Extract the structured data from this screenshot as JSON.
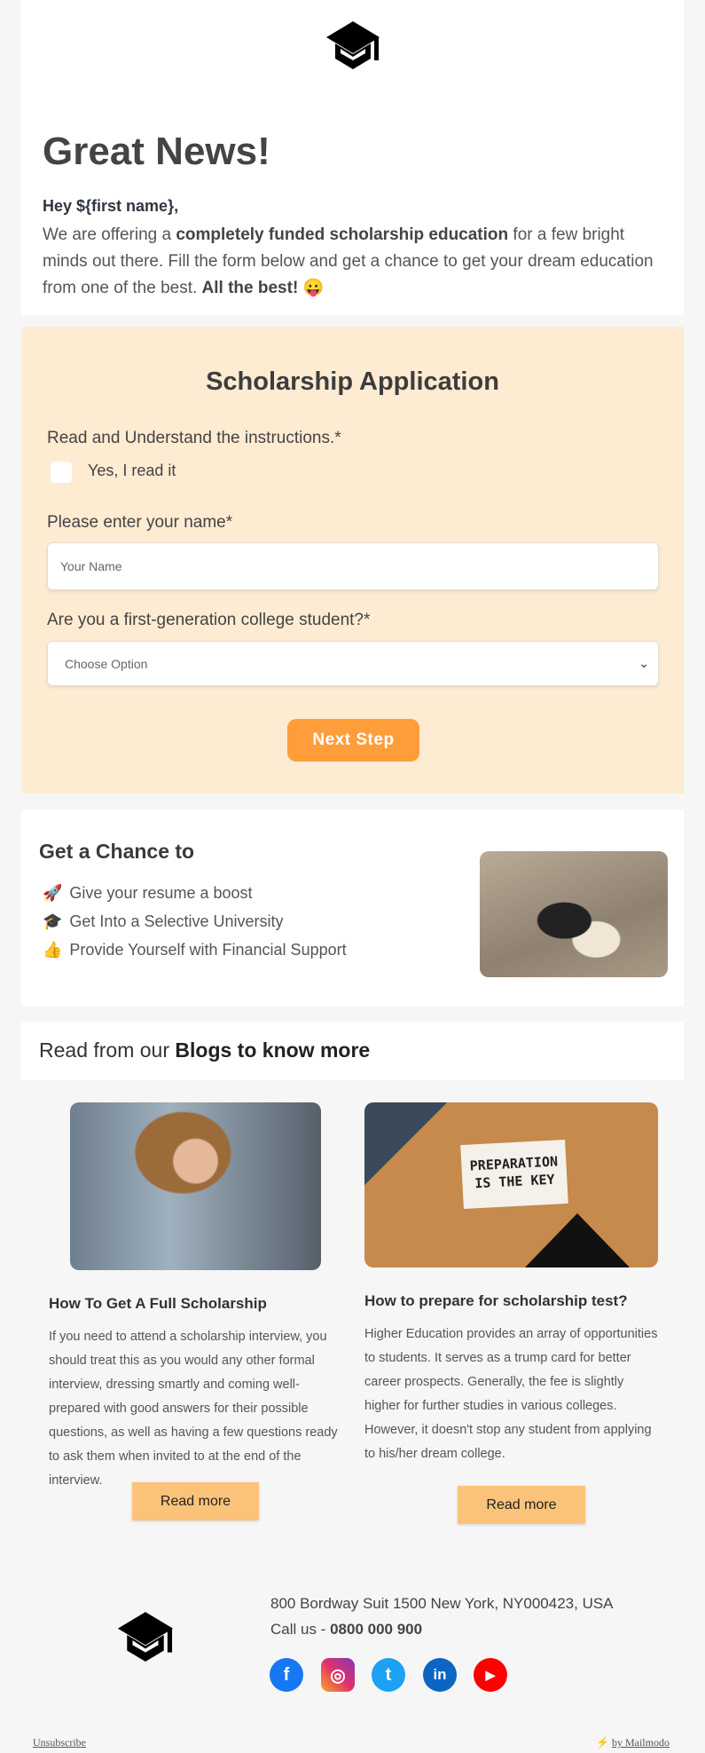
{
  "header": {
    "logo": "graduation-cap-logo",
    "title": "Great News!",
    "greeting": "Hey ${first name},",
    "intro": {
      "t1": "We are offering a ",
      "b1": "completely funded scholarship education",
      "t2": " for a few bright minds out there. Fill the form below and get a chance to get your dream education from one of the best. ",
      "b2": "All the best!",
      "emoji": "😛"
    }
  },
  "form": {
    "title": "Scholarship Application",
    "instructions_label": "Read and Understand the instructions.*",
    "checkbox_label": "Yes, I read it",
    "checkbox_checked": false,
    "name_label": "Please enter your name*",
    "name_placeholder": "Your Name",
    "name_value": "",
    "question_label": "Are you a first-generation college student?*",
    "select_value": "Choose Option",
    "next_button": "Next Step",
    "accent": "#ff9d3a",
    "background": "#fdebd2"
  },
  "chance": {
    "heading": "Get a Chance to",
    "items": [
      {
        "emoji": "🚀",
        "label": "Give your resume a boost"
      },
      {
        "emoji": "🎓",
        "label": "Get Into a Selective University"
      },
      {
        "emoji": "👍",
        "label": "Provide Yourself with Financial Support"
      }
    ]
  },
  "blogs": {
    "heading_plain": "Read from our ",
    "heading_bold": "Blogs to know more",
    "posts": [
      {
        "title": "How To Get A Full Scholarship",
        "body": "If you need to attend a scholarship interview, you should treat this as you would any other formal interview, dressing smartly and coming well-prepared with good answers for their possible questions, as well as having a few questions ready to ask them when invited to at the end of the interview.",
        "button": "Read more"
      },
      {
        "title": "How to prepare for scholarship test?",
        "image_text": "PREPARATION IS THE KEY",
        "body": "Higher Education provides an array of opportunities to students. It serves as a trump card for better career prospects. Generally, the fee is slightly higher for further studies in various colleges. However, it doesn't stop any student from applying to his/her dream college.",
        "button": "Read more"
      }
    ]
  },
  "footer": {
    "address": "800 Bordway Suit 1500 New York, NY000423, USA",
    "call_label": "Call us - ",
    "phone": "0800 000 900",
    "social": [
      {
        "name": "facebook",
        "glyph": "f",
        "color": "#1877f2"
      },
      {
        "name": "instagram",
        "glyph": "◎",
        "color": "#d6249f"
      },
      {
        "name": "twitter",
        "glyph": "t",
        "color": "#1da1f2"
      },
      {
        "name": "linkedin",
        "glyph": "in",
        "color": "#0a66c2"
      },
      {
        "name": "youtube",
        "glyph": "▶",
        "color": "#ff0000"
      }
    ],
    "unsubscribe": "Unsubscribe",
    "powered_icon": "⚡",
    "powered": "by Mailmodo"
  }
}
